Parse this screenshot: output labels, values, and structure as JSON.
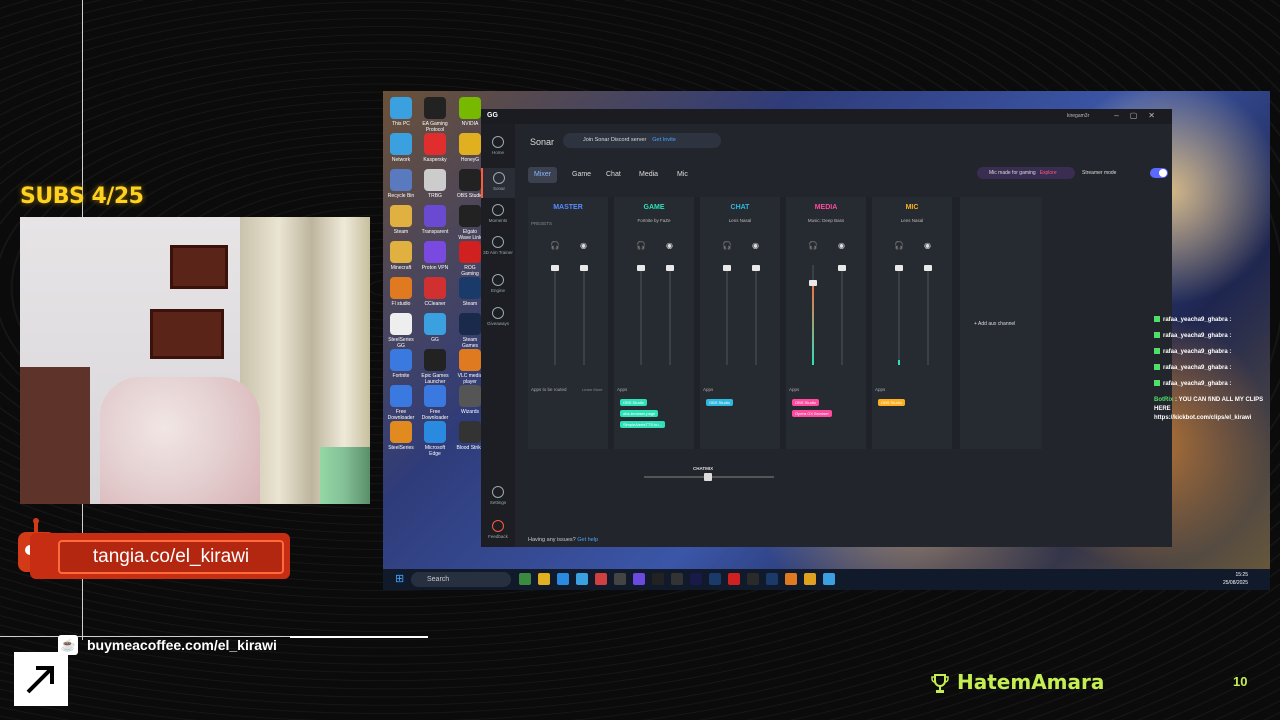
{
  "overlay": {
    "subs": "SUBS 4/25",
    "tangia": "tangia.co/el_kirawi",
    "coffee": "buymeacoffee.com/el_kirawi",
    "streamer_name": "HatemAmara",
    "count": "10",
    "accent": "#c5ee52"
  },
  "desktop_icons": [
    {
      "label": "This PC",
      "color": "#3aa0e0"
    },
    {
      "label": "EA Gaming Protocol",
      "color": "#222"
    },
    {
      "label": "NVIDIA",
      "color": "#76b900"
    },
    {
      "label": "Network",
      "color": "#3aa0e0"
    },
    {
      "label": "Kaspersky",
      "color": "#e02d2d"
    },
    {
      "label": "HoneyG",
      "color": "#e0b020"
    },
    {
      "label": "Recycle Bin",
      "color": "#5a7ac0"
    },
    {
      "label": "TRBG",
      "color": "#ccc"
    },
    {
      "label": "OBS Studio",
      "color": "#222"
    },
    {
      "label": "Steam",
      "color": "#e0b040"
    },
    {
      "label": "Transparent",
      "color": "#6a4ad0"
    },
    {
      "label": "Elgato Wave Link",
      "color": "#222"
    },
    {
      "label": "Minecraft",
      "color": "#e0b040"
    },
    {
      "label": "Proton VPN",
      "color": "#7a4ae0"
    },
    {
      "label": "ROG Gaming",
      "color": "#d02020"
    },
    {
      "label": "Fl studio",
      "color": "#e07a20"
    },
    {
      "label": "CCleaner",
      "color": "#d03030"
    },
    {
      "label": "Steam",
      "color": "#1a3a6a"
    },
    {
      "label": "SteelSeries GG",
      "color": "#eee"
    },
    {
      "label": "GG",
      "color": "#3aa0e0"
    },
    {
      "label": "Steam Games",
      "color": "#1a2a4a"
    },
    {
      "label": "Fortnite",
      "color": "#3a7ae0"
    },
    {
      "label": "Epic Games Launcher",
      "color": "#222"
    },
    {
      "label": "VLC media player",
      "color": "#e07a20"
    },
    {
      "label": "Free Downloader",
      "color": "#3a7ae0"
    },
    {
      "label": "Free Downloader",
      "color": "#3a7ae0"
    },
    {
      "label": "Wizards",
      "color": "#555"
    },
    {
      "label": "SteelSeries",
      "color": "#e08a20"
    },
    {
      "label": "Microsoft Edge",
      "color": "#2a8ae0"
    },
    {
      "label": "Blood Strike",
      "color": "#333"
    }
  ],
  "taskbar": {
    "search_placeholder": "Search",
    "time": "15:25",
    "date": "25/08/2025"
  },
  "gg": {
    "logo": "GG",
    "user": "kiregam3r",
    "sidebar": [
      {
        "label": "Home"
      },
      {
        "label": "Sonar"
      },
      {
        "label": "Moments"
      },
      {
        "label": "3D Aim Trainer"
      },
      {
        "label": "Engine"
      },
      {
        "label": "Giveaways"
      },
      {
        "label": "Settings"
      },
      {
        "label": "Feedback"
      }
    ],
    "sonar_title": "Sonar",
    "discord_pill": "Join Sonar Discord server",
    "discord_invite": "Get Invite",
    "tabs": [
      "Mixer",
      "Game",
      "Chat",
      "Media",
      "Mic"
    ],
    "mic_made": "Mic made for gaming",
    "mic_explore": "Explore",
    "streamer_mode": "Streamer mode",
    "presets_label": "PRESETS",
    "channels": [
      {
        "name": "MASTER",
        "sub": "",
        "color": "#5a8cff",
        "knob1": 0.0,
        "knob2": 0.0,
        "fill": 0.0
      },
      {
        "name": "GAME",
        "sub": "Fortnite by FaZe",
        "color": "#2fe0b8",
        "knob1": 0.0,
        "knob2": 0.0,
        "fill": 0.0
      },
      {
        "name": "CHAT",
        "sub": "Lens Nasal",
        "color": "#2fb8e0",
        "knob1": 0.0,
        "knob2": 0.0,
        "fill": 0.0
      },
      {
        "name": "MEDIA",
        "sub": "Music: Deep Bass",
        "color": "#ff4aa0",
        "knob1": 0.15,
        "knob2": 0.0,
        "fill": 0.85
      },
      {
        "name": "MIC",
        "sub": "Lens Nasal",
        "color": "#ffb020",
        "knob1": 0.0,
        "knob2": 0.0,
        "fill": 0.05
      }
    ],
    "apps_to_be_routed": "Apps to be routed",
    "learn_more": "Learn More",
    "apps_label": "Apps",
    "game_apps": [
      "OBS Studio",
      "obs-browser-page",
      "SimpleAlertsTTS.bu..."
    ],
    "chat_apps": [
      "OBS Studio"
    ],
    "media_apps": [
      "OBS Studio",
      "Opera GX Browser"
    ],
    "mic_apps": [
      "OBS Studio"
    ],
    "add_aux": "+ Add aux channel",
    "chatmix": "CHATMIX",
    "issues": "Having any issues?",
    "get_help": "Get help"
  },
  "chat": {
    "lines": [
      "rafaa_yeacha9_ghabra :",
      "rafaa_yeacha9_ghabra :",
      "rafaa_yeacha9_ghabra :",
      "rafaa_yeacha9_ghabra :",
      "rafaa_yeacha9_ghabra :"
    ],
    "bot_name": "BotRix",
    "bot_msg": ": YOU CAN fiND ALL MY CLIPS HERE",
    "bot_link": "https://kickbot.com/clips/el_kirawi"
  }
}
